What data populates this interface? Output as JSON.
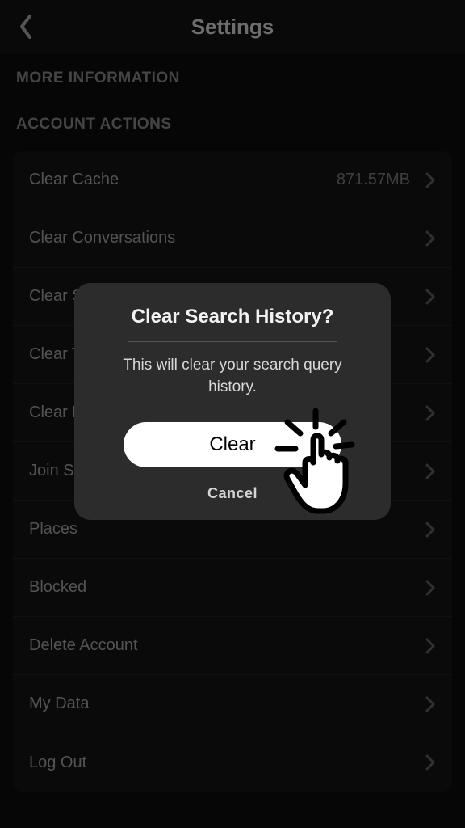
{
  "header": {
    "title": "Settings"
  },
  "sections": {
    "more_info_header": "MORE INFORMATION",
    "account_actions_header": "ACCOUNT ACTIONS"
  },
  "rows": {
    "clear_cache": {
      "label": "Clear Cache",
      "value": "871.57MB"
    },
    "clear_conversations": {
      "label": "Clear Conversations"
    },
    "clear_2": {
      "label": "Clear Search History"
    },
    "clear_3": {
      "label": "Clear Top Locations"
    },
    "clear_4": {
      "label": "Clear Lens Data"
    },
    "join": {
      "label": "Join Snapchat Beta"
    },
    "places": {
      "label": "Places"
    },
    "blocked": {
      "label": "Blocked"
    },
    "delete_account": {
      "label": "Delete Account"
    },
    "my_data": {
      "label": "My Data"
    },
    "log_out": {
      "label": "Log Out"
    }
  },
  "modal": {
    "title": "Clear Search History?",
    "message": "This will clear your search query history.",
    "primary": "Clear",
    "cancel": "Cancel"
  }
}
